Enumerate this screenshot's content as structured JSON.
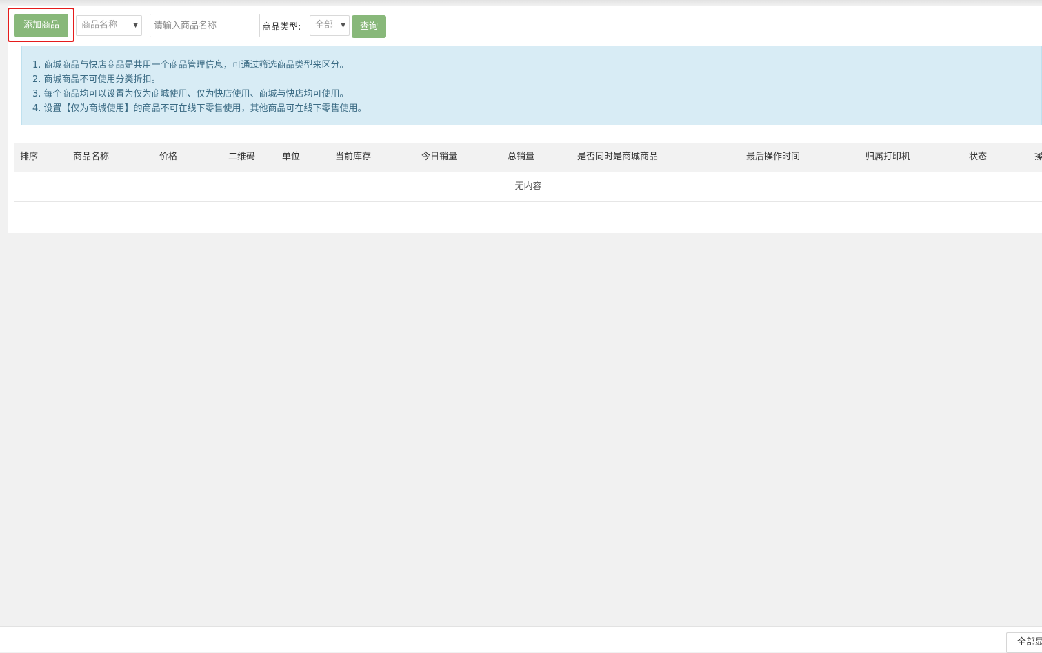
{
  "toolbar": {
    "add_button": "添加商品",
    "search_field_select": "商品名称",
    "search_placeholder": "请输入商品名称",
    "type_label": "商品类型:",
    "type_select": "全部",
    "query_button": "查询"
  },
  "notice": {
    "items": [
      "1. 商城商品与快店商品是共用一个商品管理信息，可通过筛选商品类型来区分。",
      "2. 商城商品不可使用分类折扣。",
      "3. 每个商品均可以设置为仅为商城使用、仅为快店使用、商城与快店均可使用。",
      "4. 设置【仅为商城使用】的商品不可在线下零售使用，其他商品可在线下零售使用。"
    ]
  },
  "table": {
    "columns": [
      "排序",
      "商品名称",
      "价格",
      "二维码",
      "单位",
      "当前库存",
      "今日销量",
      "总销量",
      "是否同时是商城商品",
      "最后操作时间",
      "归属打印机",
      "状态",
      "操"
    ],
    "empty_text": "无内容"
  },
  "footer": {
    "show_all_button": "全部显"
  },
  "colors": {
    "accent_green": "#88b87a",
    "highlight_red": "#e51c1c",
    "notice_bg": "#d8ecf5"
  }
}
